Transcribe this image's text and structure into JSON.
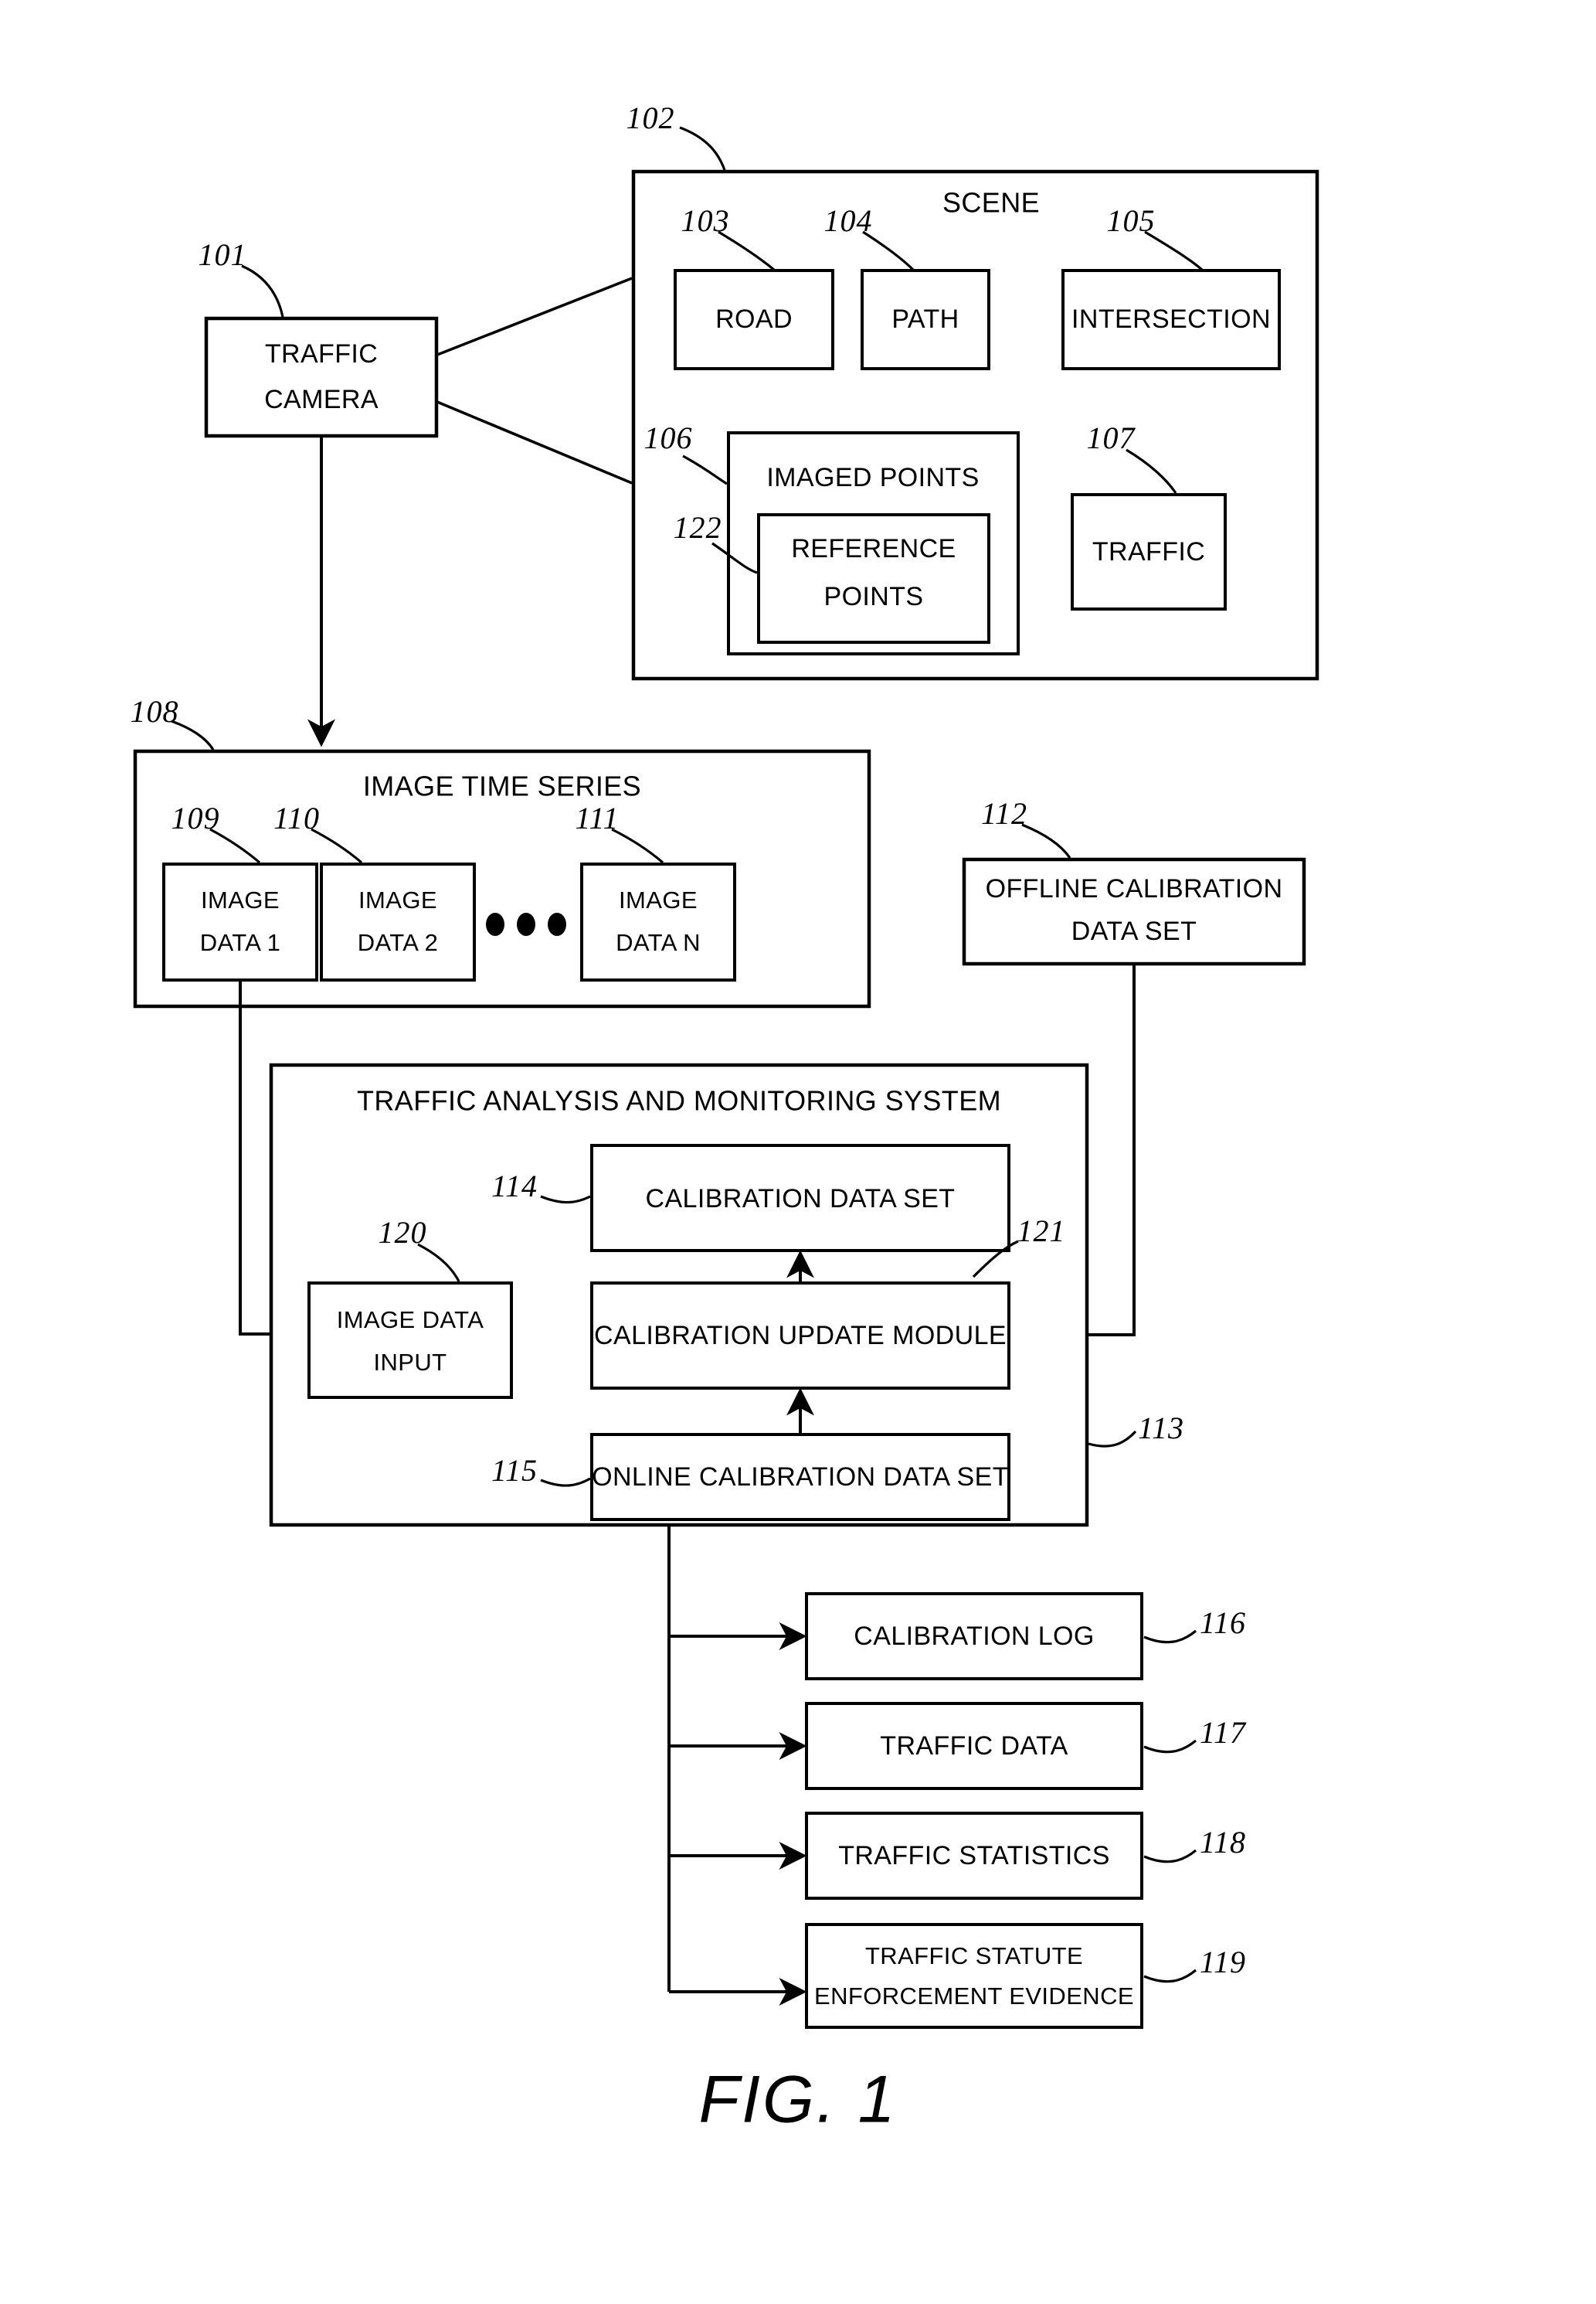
{
  "figure": {
    "caption": "FIG. 1",
    "title": "Traffic Analysis and Monitoring System"
  },
  "blocks": {
    "traffic_camera": {
      "ref": "101",
      "label_line1": "TRAFFIC",
      "label_line2": "CAMERA"
    },
    "scene": {
      "ref": "102",
      "label": "SCENE"
    },
    "road": {
      "ref": "103",
      "label": "ROAD"
    },
    "path": {
      "ref": "104",
      "label": "PATH"
    },
    "intersection": {
      "ref": "105",
      "label": "INTERSECTION"
    },
    "imaged_points": {
      "ref": "106",
      "label": "IMAGED POINTS"
    },
    "reference_points": {
      "ref": "122",
      "label_line1": "REFERENCE",
      "label_line2": "POINTS"
    },
    "traffic": {
      "ref": "107",
      "label": "TRAFFIC"
    },
    "image_time_series": {
      "ref": "108",
      "label": "IMAGE TIME SERIES"
    },
    "image_data_1": {
      "ref": "109",
      "label_line1": "IMAGE",
      "label_line2": "DATA 1"
    },
    "image_data_2": {
      "ref": "110",
      "label_line1": "IMAGE",
      "label_line2": "DATA 2"
    },
    "image_data_n": {
      "ref": "111",
      "label_line1": "IMAGE",
      "label_line2": "DATA N"
    },
    "offline_calibration_data_set": {
      "ref": "112",
      "label_line1": "OFFLINE CALIBRATION",
      "label_line2": "DATA SET"
    },
    "traffic_analysis_system": {
      "ref": "113",
      "label": "TRAFFIC ANALYSIS AND MONITORING SYSTEM"
    },
    "calibration_data_set": {
      "ref": "114",
      "label": "CALIBRATION DATA SET"
    },
    "online_calibration_data_set": {
      "ref": "115",
      "label": "ONLINE CALIBRATION DATA SET"
    },
    "image_data_input": {
      "ref": "120",
      "label_line1": "IMAGE DATA",
      "label_line2": "INPUT"
    },
    "calibration_update_module": {
      "ref": "121",
      "label": "CALIBRATION UPDATE MODULE"
    },
    "calibration_log": {
      "ref": "116",
      "label": "CALIBRATION LOG"
    },
    "traffic_data": {
      "ref": "117",
      "label": "TRAFFIC DATA"
    },
    "traffic_statistics": {
      "ref": "118",
      "label": "TRAFFIC STATISTICS"
    },
    "traffic_statute_enforcement_evidence": {
      "ref": "119",
      "label_line1": "TRAFFIC STATUTE",
      "label_line2": "ENFORCEMENT EVIDENCE"
    }
  },
  "ellipsis": {
    "label": "•••"
  },
  "colors": {
    "ink": "#000000",
    "paper": "#ffffff"
  }
}
